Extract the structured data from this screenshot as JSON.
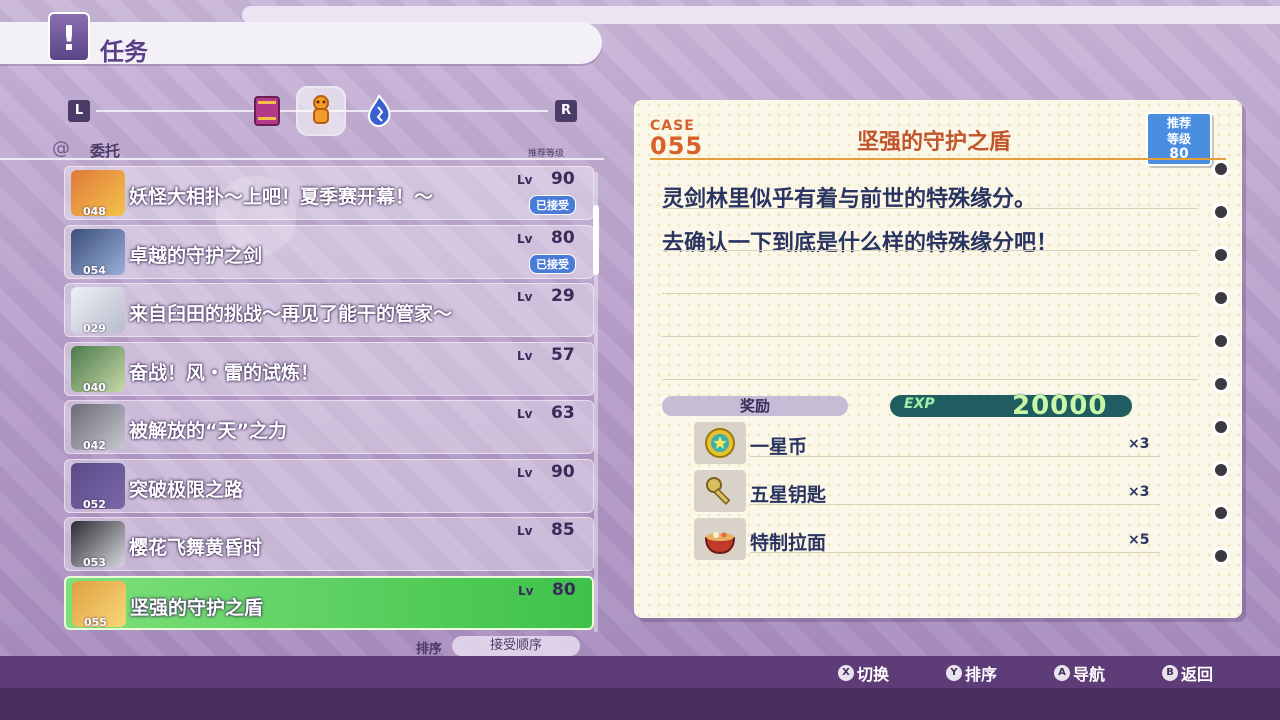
{
  "header": {
    "title": "任务",
    "icon": "exclamation-icon"
  },
  "switcher": {
    "left_btn": "L",
    "right_btn": "R",
    "categories": [
      "book-icon",
      "gingerbread-icon",
      "flame-icon"
    ]
  },
  "section": {
    "label": "委托",
    "rec_header": "推荐等级"
  },
  "quests": [
    {
      "title": "妖怪大相扑～上吧！夏季赛开幕！～",
      "num": "048",
      "lv": "Lv",
      "level": "90",
      "accepted": "已接受"
    },
    {
      "title": "卓越的守护之剑",
      "num": "054",
      "lv": "Lv",
      "level": "80",
      "accepted": "已接受"
    },
    {
      "title": "来自臼田的挑战～再见了能干的管家～",
      "num": "029",
      "lv": "Lv",
      "level": "29",
      "accepted": ""
    },
    {
      "title": "奋战！风・雷的试炼！",
      "num": "040",
      "lv": "Lv",
      "level": "57",
      "accepted": ""
    },
    {
      "title": "被解放的“天”之力",
      "num": "042",
      "lv": "Lv",
      "level": "63",
      "accepted": ""
    },
    {
      "title": "突破极限之路",
      "num": "052",
      "lv": "Lv",
      "level": "90",
      "accepted": ""
    },
    {
      "title": "樱花飞舞黄昏时",
      "num": "053",
      "lv": "Lv",
      "level": "85",
      "accepted": ""
    },
    {
      "title": "坚强的守护之盾",
      "num": "055",
      "lv": "Lv",
      "level": "80",
      "accepted": ""
    }
  ],
  "sort": {
    "label": "排序",
    "value": "接受顺序"
  },
  "detail": {
    "case_label": "CASE",
    "case_num": "055",
    "title": "坚强的守护之盾",
    "rec_line1": "推荐",
    "rec_line2": "等级",
    "rec_level": "80",
    "desc_line1": "灵剑林里似乎有着与前世的特殊缘分。",
    "desc_line2": "去确认一下到底是什么样的特殊缘分吧！",
    "reward_label": "奖励",
    "exp_label": "EXP",
    "exp_value": "20000",
    "rewards": [
      {
        "name": "一星币",
        "qty": "×3",
        "icon": "star-coin-icon"
      },
      {
        "name": "五星钥匙",
        "qty": "×3",
        "icon": "key-icon"
      },
      {
        "name": "特制拉面",
        "qty": "×5",
        "icon": "ramen-icon"
      }
    ]
  },
  "footer": {
    "hints": [
      {
        "btn": "X",
        "label": "切换"
      },
      {
        "btn": "Y",
        "label": "排序"
      },
      {
        "btn": "A",
        "label": "导航"
      },
      {
        "btn": "B",
        "label": "返回"
      }
    ]
  }
}
